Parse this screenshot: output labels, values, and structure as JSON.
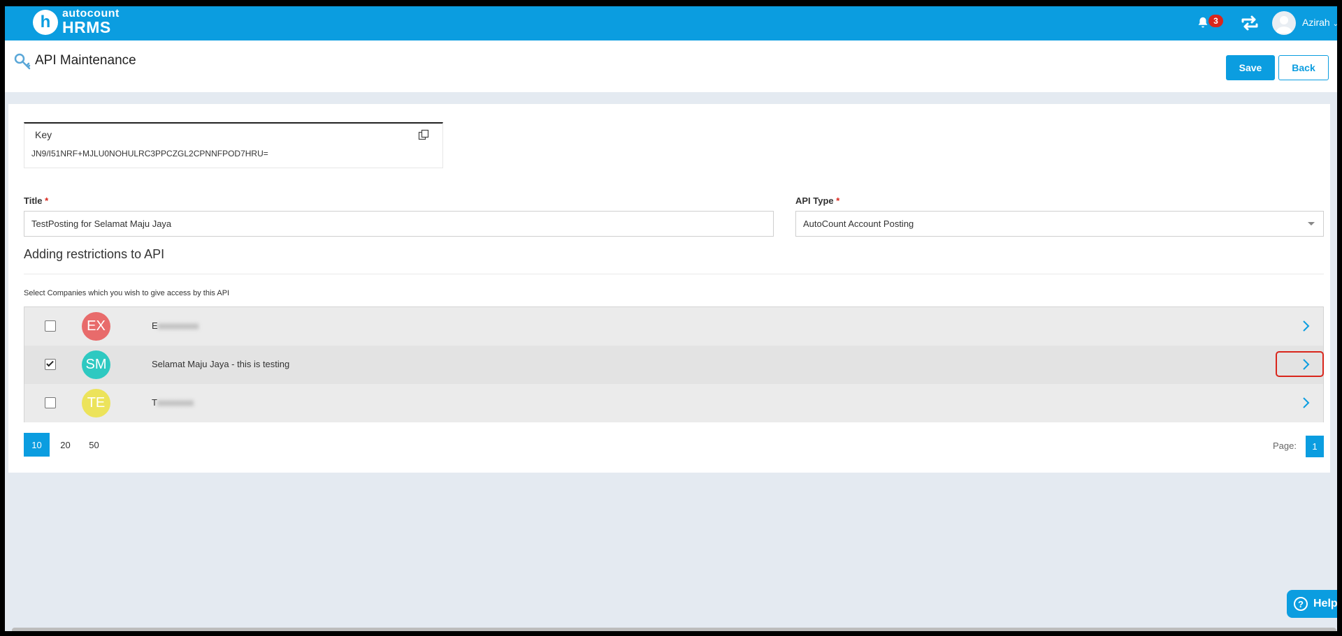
{
  "brand": {
    "logo_letter": "h",
    "logo_small": "autocount",
    "logo_big": "HRMS"
  },
  "header": {
    "notification_count": "3",
    "user_name": "Azirah"
  },
  "page": {
    "title": "API Maintenance",
    "save_label": "Save",
    "back_label": "Back"
  },
  "key": {
    "label": "Key",
    "value": "JN9/I51NRF+MJLU0NOHULRC3PPCZGL2CPNNFPOD7HRU="
  },
  "form": {
    "title_label": "Title",
    "title_value": "TestPosting for Selamat Maju Jaya",
    "required_mark": "*",
    "api_type_label": "API Type",
    "api_type_value": "AutoCount Account Posting"
  },
  "restrictions": {
    "heading": "Adding restrictions to API",
    "instruction": "Select Companies which you wish to give access by this API",
    "companies": [
      {
        "initials": "EX",
        "name": "E",
        "checked": false,
        "color": "#e86b6b",
        "redacted": true
      },
      {
        "initials": "SM",
        "name": "Selamat Maju Jaya - this is testing",
        "checked": true,
        "color": "#2ec9c1",
        "redacted": false
      },
      {
        "initials": "TE",
        "name": "T",
        "checked": false,
        "color": "#ece35b",
        "redacted": true
      }
    ]
  },
  "pagination": {
    "sizes": [
      "10",
      "20",
      "50"
    ],
    "active_size": "10",
    "page_label": "Page:",
    "current_page": "1"
  },
  "help": {
    "label": "Help",
    "glyph": "?"
  },
  "colors": {
    "primary": "#0b9de0",
    "danger": "#d9261c",
    "background": "#e4eaf1"
  }
}
